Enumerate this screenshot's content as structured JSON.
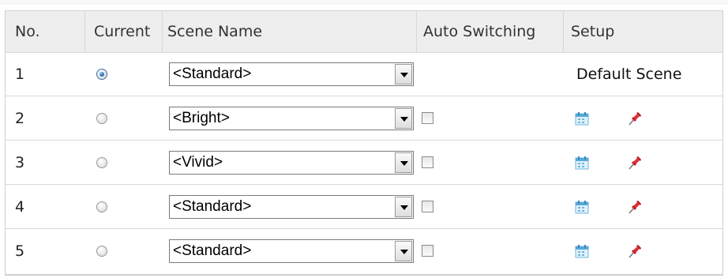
{
  "header": {
    "no": "No.",
    "current": "Current",
    "scene_name": "Scene Name",
    "auto_switching": "Auto Switching",
    "setup": "Setup"
  },
  "rows": [
    {
      "no": "1",
      "current": true,
      "scene": "<Standard>",
      "auto_switching": null,
      "setup_text": "Default Scene"
    },
    {
      "no": "2",
      "current": false,
      "scene": "<Bright>",
      "auto_switching": false,
      "setup_text": null
    },
    {
      "no": "3",
      "current": false,
      "scene": "<Vivid>",
      "auto_switching": false,
      "setup_text": null
    },
    {
      "no": "4",
      "current": false,
      "scene": "<Standard>",
      "auto_switching": false,
      "setup_text": null
    },
    {
      "no": "5",
      "current": false,
      "scene": "<Standard>",
      "auto_switching": false,
      "setup_text": null
    }
  ],
  "icons": {
    "schedule": "calendar-icon",
    "edit": "pushpin-icon"
  },
  "colors": {
    "header_bg": "#eeeeee",
    "border": "#d9d9d9",
    "radio_selected": "#2c6fb5",
    "pin_red": "#d0202a"
  }
}
